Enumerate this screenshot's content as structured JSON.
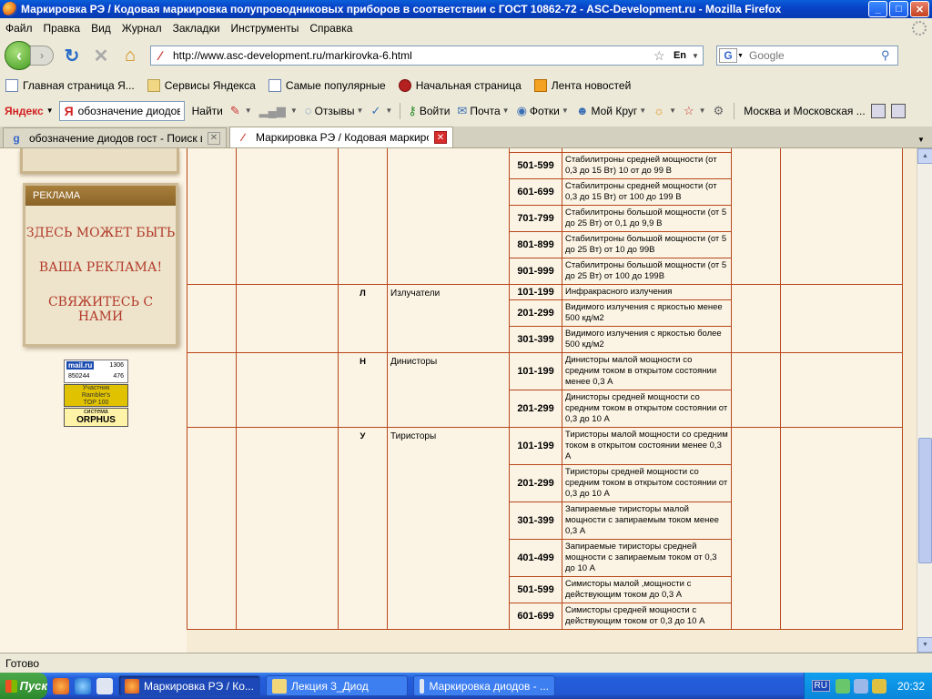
{
  "window": {
    "title": "Маркировка РЭ / Кодовая маркировка полупроводниковых приборов в соответствии с ГОСТ 10862-72 - ASC-Development.ru - Mozilla Firefox",
    "min": "_",
    "max": "□",
    "close": "✕"
  },
  "menu": [
    "Файл",
    "Правка",
    "Вид",
    "Журнал",
    "Закладки",
    "Инструменты",
    "Справка"
  ],
  "nav": {
    "url": "http://www.asc-development.ru/markirovka-6.html",
    "lang_badge": "En",
    "search_placeholder": "Google"
  },
  "bookmarks": [
    {
      "label": "Главная страница Я...",
      "icon": "page-icon"
    },
    {
      "label": "Сервисы Яндекса",
      "icon": "folder-icon"
    },
    {
      "label": "Самые популярные",
      "icon": "page-icon"
    },
    {
      "label": "Начальная страница",
      "icon": "firefox-icon"
    },
    {
      "label": "Лента новостей",
      "icon": "rss-icon"
    }
  ],
  "yandex": {
    "logo": "Яндекс",
    "query": "обозначение диодов",
    "find": "Найти",
    "reviews": "Отзывы",
    "login": "Войти",
    "mail": "Почта",
    "photos": "Фотки",
    "my_circle": "Мой Круг",
    "region": "Москва и Московская ..."
  },
  "tabs": [
    {
      "label": "обозначение диодов гост - Поиск в ...",
      "active": false
    },
    {
      "label": "Маркировка РЭ / Кодовая маркировка...",
      "active": true
    }
  ],
  "sidebar": {
    "ad_header": "РЕКЛАМА",
    "ad_line1": "ЗДЕСЬ МОЖЕТ БЫТЬ",
    "ad_line2": "ВАША РЕКЛАМА!",
    "ad_line3": "СВЯЖИТЕСЬ С НАМИ",
    "counter_logo": "mail.ru",
    "counter_a": "1306",
    "counter_b": "850244",
    "counter_c": "476",
    "rambler_1": "Участник",
    "rambler_2": "Rambler's",
    "rambler_3": "TOP 100",
    "orphus_1": "система",
    "orphus_2": "ORPHUS"
  },
  "table": {
    "groups": [
      {
        "symbol": "",
        "name": "",
        "rows": [
          {
            "code": "",
            "desc": "(от 0,3 до 15 Вт) от 0,1 до 9,9 В"
          },
          {
            "code": "501-599",
            "desc": "Стабилитроны средней мощности (от 0,3 до 15 Вт) 10 от до 99 В"
          },
          {
            "code": "601-699",
            "desc": "Стабилитроны средней мощности (от 0,3 до 15 Вт) от 100 до 199 В"
          },
          {
            "code": "701-799",
            "desc": "Стабилитроны большой мощности (от 5 до 25 Вт) от 0,1 до 9,9 В"
          },
          {
            "code": "801-899",
            "desc": "Стабилитроны большой мощности (от 5 до 25 Вт) от 10 до 99В"
          },
          {
            "code": "901-999",
            "desc": "Стабилитроны большой мощности (от 5 до 25 Вт) от 100 до 199В"
          }
        ]
      },
      {
        "symbol": "Л",
        "name": "Излучатели",
        "rows": [
          {
            "code": "101-199",
            "desc": "Инфракрасного излучения"
          },
          {
            "code": "201-299",
            "desc": "Видимого излучения с яркостью менее 500 кд/м2"
          },
          {
            "code": "301-399",
            "desc": "Видимого излучения с яркостью более 500 кд/м2"
          }
        ]
      },
      {
        "symbol": "Н",
        "name": "Динисторы",
        "rows": [
          {
            "code": "101-199",
            "desc": "Динисторы малой мощности со средним током в открытом состоянии менее 0,3 А"
          },
          {
            "code": "201-299",
            "desc": "Динисторы средней мощности со средним током в открытом состоянии от 0,3 до 10 А"
          }
        ]
      },
      {
        "symbol": "У",
        "name": "Тиристоры",
        "rows": [
          {
            "code": "101-199",
            "desc": "Тиристоры малой мощности со средним током в открытом состоянии менее 0,3 А"
          },
          {
            "code": "201-299",
            "desc": "Тиристоры средней мощности со средним током в открытом состоянии от 0,3 до 10 А"
          },
          {
            "code": "301-399",
            "desc": "Запираемые тиристоры малой мощности с запираемым током менее 0,3 А"
          },
          {
            "code": "401-499",
            "desc": "Запираемые тиристоры средней мощности с запираемым током от 0,3 до 10 А"
          },
          {
            "code": "501-599",
            "desc": "Симисторы малой ,мощности с действующим током до 0,3 А"
          },
          {
            "code": "601-699",
            "desc": "Симисторы средней мощности с действующим током от 0,3 до 10 А"
          }
        ]
      }
    ]
  },
  "status": "Готово",
  "taskbar": {
    "start": "Пуск",
    "buttons": [
      {
        "label": "Маркировка РЭ / Ко...",
        "active": true
      },
      {
        "label": "Лекция 3_Диод",
        "active": false
      },
      {
        "label": "Маркировка диодов - ...",
        "active": false
      }
    ],
    "lang": "RU",
    "time": "20:32"
  }
}
